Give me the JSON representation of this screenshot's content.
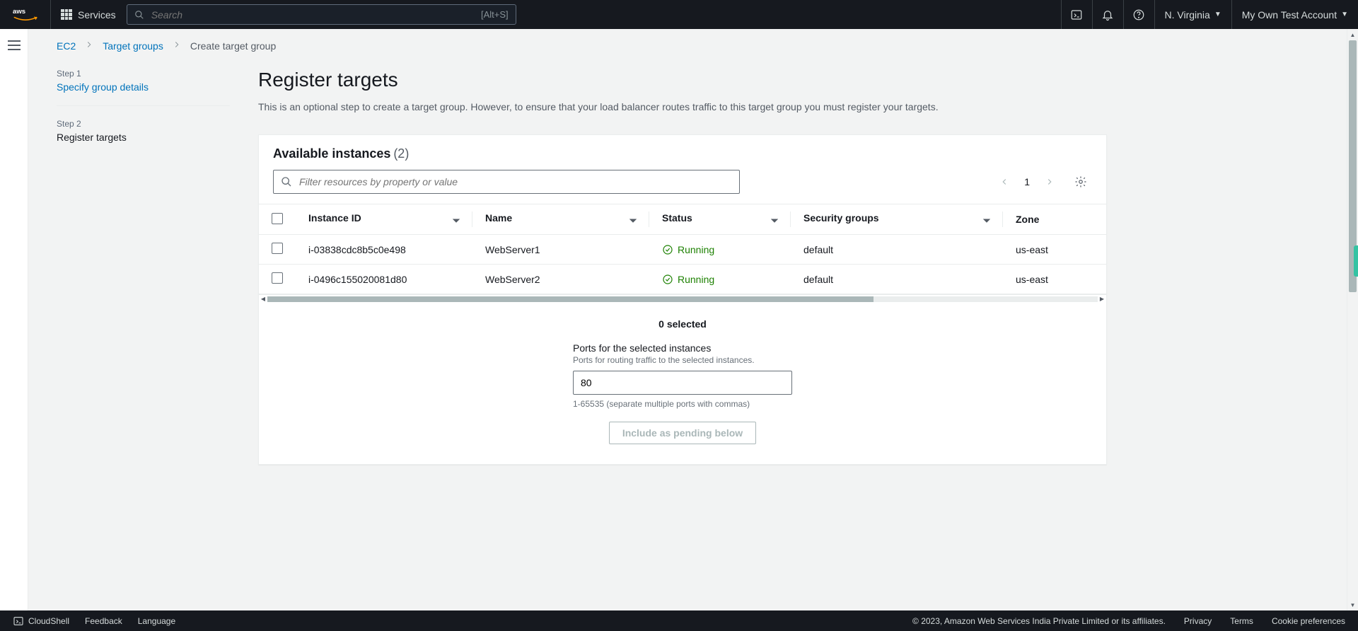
{
  "nav": {
    "services": "Services",
    "search_placeholder": "Search",
    "search_hotkey": "[Alt+S]",
    "region": "N. Virginia",
    "account": "My Own Test Account"
  },
  "breadcrumb": {
    "a": "EC2",
    "b": "Target groups",
    "c": "Create target group"
  },
  "steps": {
    "s1_num": "Step 1",
    "s1_title": "Specify group details",
    "s2_num": "Step 2",
    "s2_title": "Register targets"
  },
  "page": {
    "title": "Register targets",
    "sub": "This is an optional step to create a target group. However, to ensure that your load balancer routes traffic to this target group you must register your targets."
  },
  "panel": {
    "title": "Available instances",
    "count": "(2)",
    "filter_placeholder": "Filter resources by property or value",
    "page_num": "1",
    "columns": {
      "instance_id": "Instance ID",
      "name": "Name",
      "status": "Status",
      "sec_groups": "Security groups",
      "zone": "Zone"
    },
    "rows": [
      {
        "id": "i-03838cdc8b5c0e498",
        "name": "WebServer1",
        "status": "Running",
        "sg": "default",
        "zone": "us-east"
      },
      {
        "id": "i-0496c155020081d80",
        "name": "WebServer2",
        "status": "Running",
        "sg": "default",
        "zone": "us-east"
      }
    ],
    "selected_text": "0 selected",
    "ports_label": "Ports for the selected instances",
    "ports_help": "Ports for routing traffic to the selected instances.",
    "ports_value": "80",
    "ports_hint": "1-65535 (separate multiple ports with commas)",
    "include_btn": "Include as pending below"
  },
  "footer": {
    "cloudshell": "CloudShell",
    "feedback": "Feedback",
    "language": "Language",
    "copyright": "© 2023, Amazon Web Services India Private Limited or its affiliates.",
    "privacy": "Privacy",
    "terms": "Terms",
    "cookies": "Cookie preferences"
  }
}
